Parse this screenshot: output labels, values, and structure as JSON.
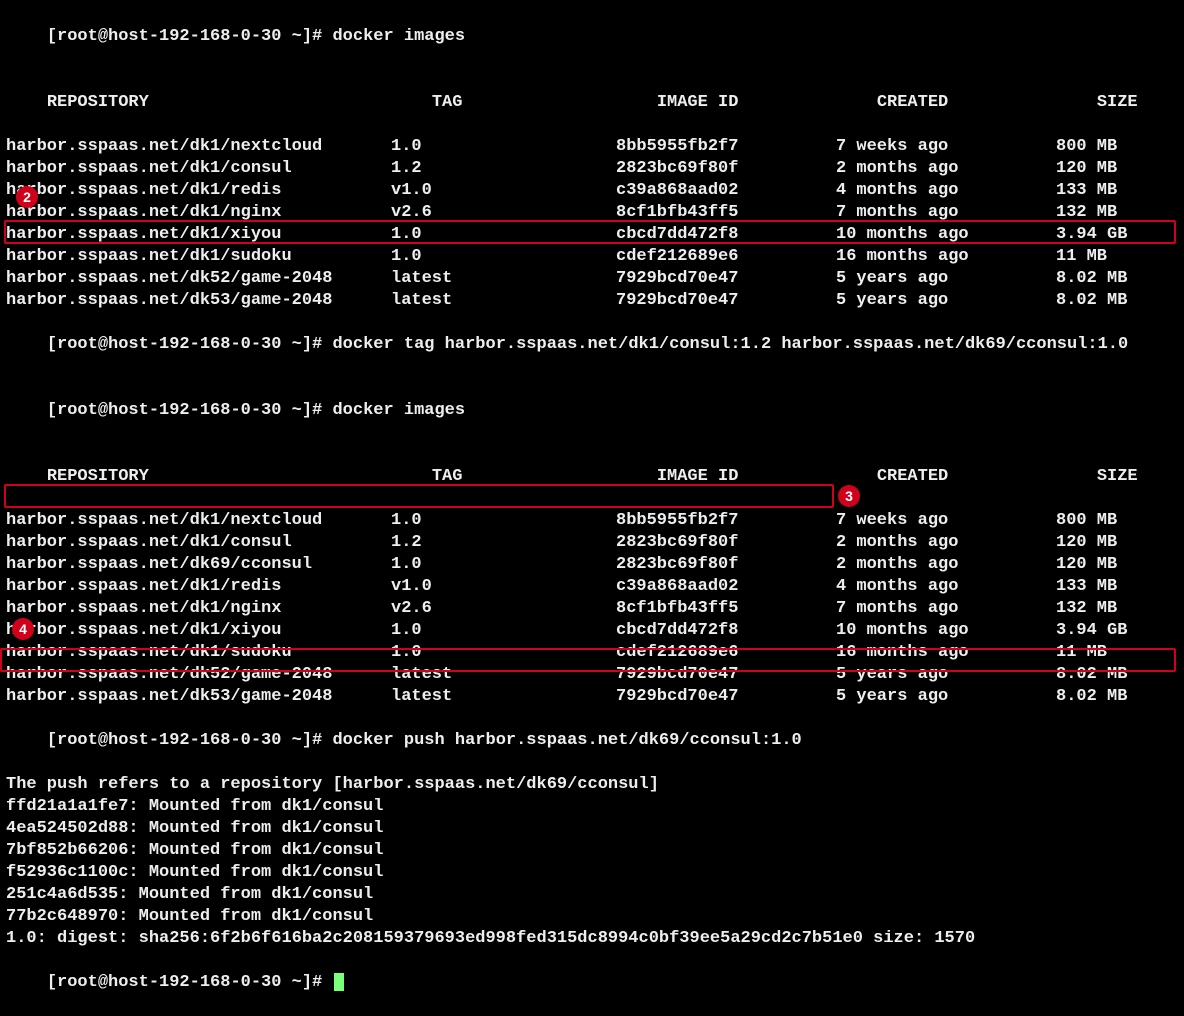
{
  "prompt": "[root@host-192-168-0-30 ~]# ",
  "commands": {
    "images1": "docker images",
    "tag": "docker tag harbor.sspaas.net/dk1/consul:1.2 harbor.sspaas.net/dk69/cconsul:1.0",
    "images2": "docker images",
    "push": "docker push harbor.sspaas.net/dk69/cconsul:1.0"
  },
  "headers": {
    "repo": "REPOSITORY",
    "tag": "TAG",
    "id": "IMAGE ID",
    "created": "CREATED",
    "size": "SIZE"
  },
  "table1": [
    {
      "repo": "harbor.sspaas.net/dk1/nextcloud",
      "tag": "1.0",
      "id": "8bb5955fb2f7",
      "created": "7 weeks ago",
      "size": "800 MB"
    },
    {
      "repo": "harbor.sspaas.net/dk1/consul",
      "tag": "1.2",
      "id": "2823bc69f80f",
      "created": "2 months ago",
      "size": "120 MB"
    },
    {
      "repo": "harbor.sspaas.net/dk1/redis",
      "tag": "v1.0",
      "id": "c39a868aad02",
      "created": "4 months ago",
      "size": "133 MB"
    },
    {
      "repo": "harbor.sspaas.net/dk1/nginx",
      "tag": "v2.6",
      "id": "8cf1bfb43ff5",
      "created": "7 months ago",
      "size": "132 MB"
    },
    {
      "repo": "harbor.sspaas.net/dk1/xiyou",
      "tag": "1.0",
      "id": "cbcd7dd472f8",
      "created": "10 months ago",
      "size": "3.94 GB"
    },
    {
      "repo": "harbor.sspaas.net/dk1/sudoku",
      "tag": "1.0",
      "id": "cdef212689e6",
      "created": "16 months ago",
      "size": "11 MB"
    },
    {
      "repo": "harbor.sspaas.net/dk52/game-2048",
      "tag": "latest",
      "id": "7929bcd70e47",
      "created": "5 years ago",
      "size": "8.02 MB"
    },
    {
      "repo": "harbor.sspaas.net/dk53/game-2048",
      "tag": "latest",
      "id": "7929bcd70e47",
      "created": "5 years ago",
      "size": "8.02 MB"
    }
  ],
  "table2": [
    {
      "repo": "harbor.sspaas.net/dk1/nextcloud",
      "tag": "1.0",
      "id": "8bb5955fb2f7",
      "created": "7 weeks ago",
      "size": "800 MB"
    },
    {
      "repo": "harbor.sspaas.net/dk1/consul",
      "tag": "1.2",
      "id": "2823bc69f80f",
      "created": "2 months ago",
      "size": "120 MB"
    },
    {
      "repo": "harbor.sspaas.net/dk69/cconsul",
      "tag": "1.0",
      "id": "2823bc69f80f",
      "created": "2 months ago",
      "size": "120 MB"
    },
    {
      "repo": "harbor.sspaas.net/dk1/redis",
      "tag": "v1.0",
      "id": "c39a868aad02",
      "created": "4 months ago",
      "size": "133 MB"
    },
    {
      "repo": "harbor.sspaas.net/dk1/nginx",
      "tag": "v2.6",
      "id": "8cf1bfb43ff5",
      "created": "7 months ago",
      "size": "132 MB"
    },
    {
      "repo": "harbor.sspaas.net/dk1/xiyou",
      "tag": "1.0",
      "id": "cbcd7dd472f8",
      "created": "10 months ago",
      "size": "3.94 GB"
    },
    {
      "repo": "harbor.sspaas.net/dk1/sudoku",
      "tag": "1.0",
      "id": "cdef212689e6",
      "created": "16 months ago",
      "size": "11 MB"
    },
    {
      "repo": "harbor.sspaas.net/dk52/game-2048",
      "tag": "latest",
      "id": "7929bcd70e47",
      "created": "5 years ago",
      "size": "8.02 MB"
    },
    {
      "repo": "harbor.sspaas.net/dk53/game-2048",
      "tag": "latest",
      "id": "7929bcd70e47",
      "created": "5 years ago",
      "size": "8.02 MB"
    }
  ],
  "pushOutput": {
    "refers": "The push refers to a repository [harbor.sspaas.net/dk69/cconsul]",
    "layers": [
      "ffd21a1a1fe7: Mounted from dk1/consul",
      "4ea524502d88: Mounted from dk1/consul",
      "7bf852b66206: Mounted from dk1/consul",
      "f52936c1100c: Mounted from dk1/consul",
      "251c4a6d535: Mounted from dk1/consul",
      "77b2c648970: Mounted from dk1/consul"
    ],
    "digest": "1.0: digest: sha256:6f2b6f616ba2c208159379693ed998fed315dc8994c0bf39ee5a29cd2c7b51e0 size: 1570"
  },
  "annotations": {
    "badge2": "2",
    "badge3": "3",
    "badge4": "4"
  }
}
